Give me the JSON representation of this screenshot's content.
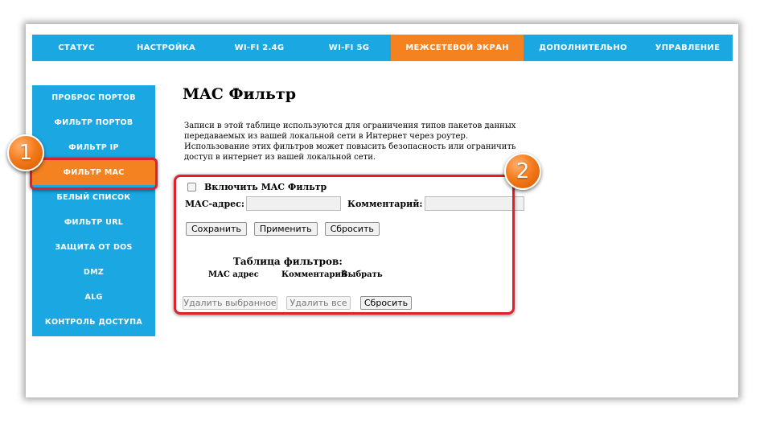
{
  "top_nav": [
    {
      "label": "СТАТУС",
      "active": false
    },
    {
      "label": "НАСТРОЙКА",
      "active": false
    },
    {
      "label": "WI-FI 2.4G",
      "active": false
    },
    {
      "label": "WI-FI 5G",
      "active": false
    },
    {
      "label": "МЕЖСЕТЕВОЙ ЭКРАН",
      "active": true
    },
    {
      "label": "ДОПОЛНИТЕЛЬНО",
      "active": false
    },
    {
      "label": "УПРАВЛЕНИЕ",
      "active": false
    }
  ],
  "side_nav": [
    {
      "label": "ПРОБРОС ПОРТОВ",
      "active": false
    },
    {
      "label": "ФИЛЬТР ПОРТОВ",
      "active": false
    },
    {
      "label": "ФИЛЬТР IP",
      "active": false
    },
    {
      "label": "ФИЛЬТР МАС",
      "active": true
    },
    {
      "label": "БЕЛЫЙ СПИСОК",
      "active": false
    },
    {
      "label": "ФИЛЬТР URL",
      "active": false
    },
    {
      "label": "ЗАЩИТА ОТ DOS",
      "active": false
    },
    {
      "label": "DMZ",
      "active": false
    },
    {
      "label": "ALG",
      "active": false
    },
    {
      "label": "КОНТРОЛЬ ДОСТУПА",
      "active": false
    }
  ],
  "badges": {
    "first": "1",
    "second": "2"
  },
  "main": {
    "title": "MAC Фильтр",
    "description": "Записи в этой таблице используются для ограничения типов пакетов данных передаваемых из вашей локальной сети в Интернет через роутер. Использование этих фильтров может повысить безопасность или ограничить доступ в интернет из вашей локальной сети.",
    "enable_label": "Включить MAC Фильтр",
    "enable_checked": false,
    "mac_label": "MAC-адрес:",
    "mac_value": "",
    "comment_label": "Комментарий:",
    "comment_value": "",
    "save_button": "Сохранить",
    "apply_button": "Применить",
    "reset_button": "Сбросить",
    "table_title": "Таблица фильтров:",
    "columns": [
      "MAC адрес",
      "Комментарий",
      "Выбрать"
    ],
    "delete_selected_button": "Удалить выбранное",
    "delete_all_button": "Удалить все",
    "table_reset_button": "Сбросить"
  },
  "colors": {
    "nav_blue": "#1aa7e2",
    "active_orange": "#f58220",
    "highlight_red": "#e0202a"
  }
}
